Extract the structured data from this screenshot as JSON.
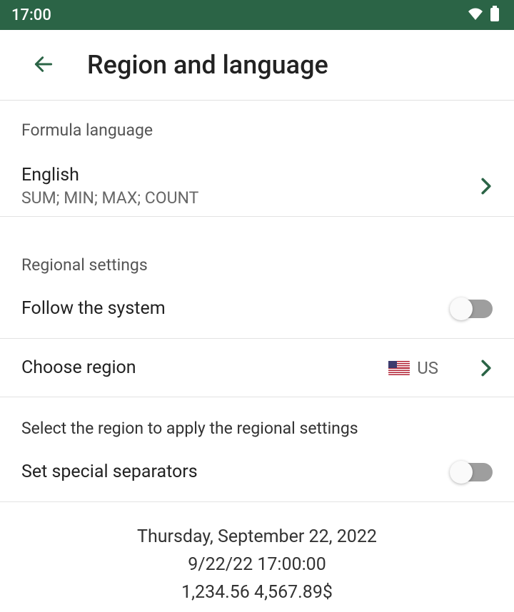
{
  "status": {
    "time": "17:00"
  },
  "header": {
    "title": "Region and language"
  },
  "formula": {
    "section_label": "Formula language",
    "value": "English",
    "functions": "SUM; MIN; MAX; COUNT"
  },
  "regional": {
    "section_label": "Regional settings",
    "follow_system_label": "Follow the system",
    "follow_system_on": false,
    "choose_region_label": "Choose region",
    "region_value": "US",
    "note": "Select the region to apply the regional settings",
    "set_separators_label": "Set special separators",
    "set_separators_on": false
  },
  "example": {
    "line1": "Thursday, September 22, 2022",
    "line2": "9/22/22 17:00:00",
    "line3": "1,234.56 4,567.89$"
  }
}
